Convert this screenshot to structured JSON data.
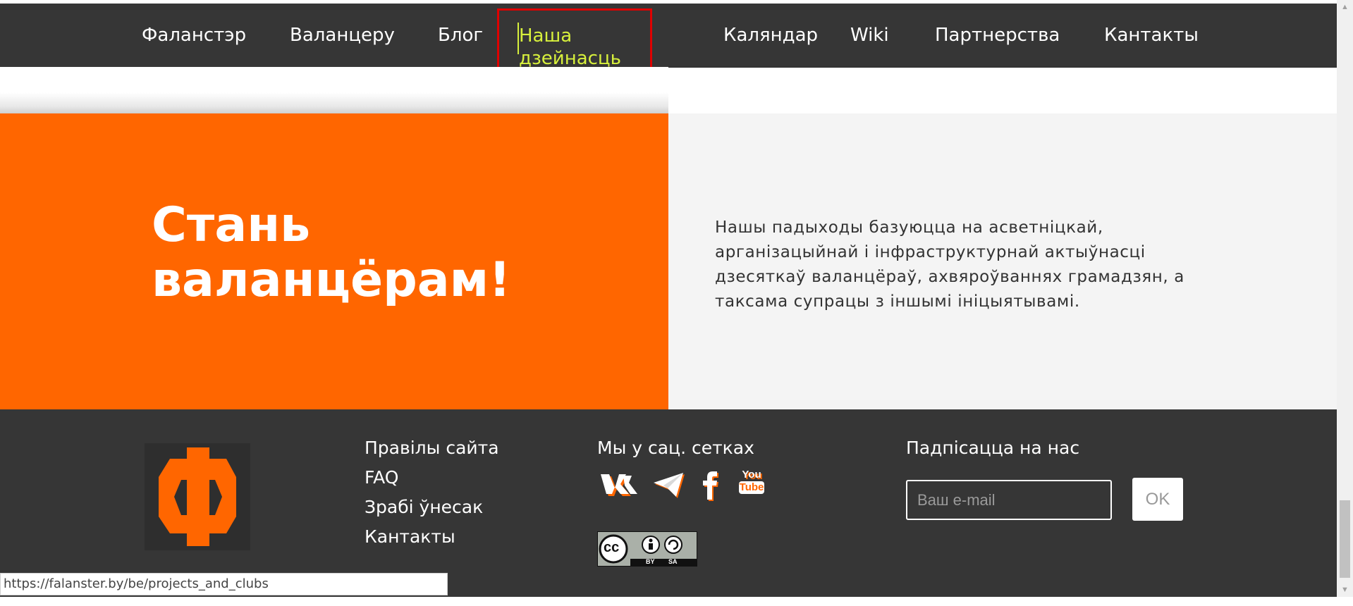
{
  "nav": {
    "items": [
      {
        "label": "Фаланстэр"
      },
      {
        "label": "Валанцеру"
      },
      {
        "label": "Блог"
      },
      {
        "label": "Наша дзейнасць"
      },
      {
        "label": "Каляндар"
      },
      {
        "label": "Wiki"
      },
      {
        "label": "Партнерства"
      },
      {
        "label": "Кантакты"
      }
    ],
    "active_color": "#d7f03c",
    "highlight_color": "#e00000"
  },
  "hero": {
    "title": "Стань валанцёрам!",
    "text": "Нашы падыходы базуюцца на асветніцкай, арганізацыйнай і інфраструктурнай актыўнасці дзесяткаў валанцёраў, ахвяроўваннях грамадзян, а таксама супрацы з іншымі ініцыятывамі.",
    "accent": "#ff6600"
  },
  "footer": {
    "logo": {
      "letter": "Ф",
      "icon": "falanster-logo-icon"
    },
    "links": [
      {
        "label": "Правілы сайта"
      },
      {
        "label": "FAQ"
      },
      {
        "label": "Зрабі ўнесак"
      },
      {
        "label": "Кантакты"
      }
    ],
    "social": {
      "title": "Мы у сац. сетках",
      "icons": [
        "vk-icon",
        "telegram-icon",
        "facebook-icon",
        "youtube-icon"
      ],
      "youtube_top": "You",
      "youtube_bottom": "Tube",
      "license": {
        "cc": "cc",
        "by": "BY",
        "sa": "SA"
      }
    },
    "subscribe": {
      "title": "Падпісацца на нас",
      "placeholder": "Ваш e-mail",
      "button": "OK"
    }
  },
  "status_url": "https://falanster.by/be/projects_and_clubs"
}
